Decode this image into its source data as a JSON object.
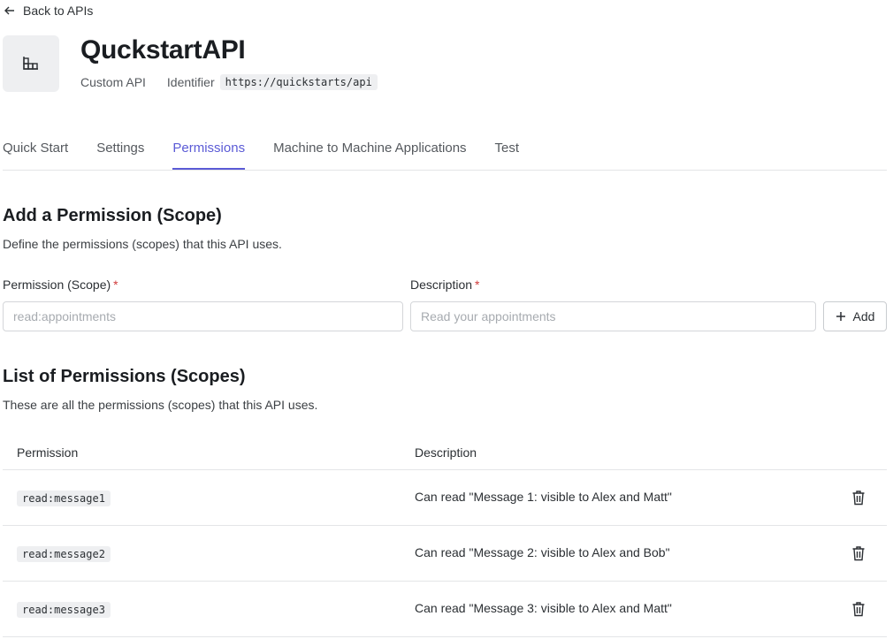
{
  "back_link": {
    "label": "Back to APIs"
  },
  "header": {
    "icon": "building-grid-icon",
    "title": "QuckstartAPI",
    "type_label": "Custom API",
    "identifier_label": "Identifier",
    "identifier_value": "https://quickstarts/api"
  },
  "tabs": [
    {
      "label": "Quick Start",
      "active": false
    },
    {
      "label": "Settings",
      "active": false
    },
    {
      "label": "Permissions",
      "active": true
    },
    {
      "label": "Machine to Machine Applications",
      "active": false
    },
    {
      "label": "Test",
      "active": false
    }
  ],
  "add_section": {
    "title": "Add a Permission (Scope)",
    "subtitle": "Define the permissions (scopes) that this API uses.",
    "permission_label": "Permission (Scope)",
    "permission_placeholder": "read:appointments",
    "description_label": "Description",
    "description_placeholder": "Read your appointments",
    "required_marker": "*",
    "add_button": "Add"
  },
  "list_section": {
    "title": "List of Permissions (Scopes)",
    "subtitle": "These are all the permissions (scopes) that this API uses.",
    "columns": {
      "permission": "Permission",
      "description": "Description"
    },
    "rows": [
      {
        "permission": "read:message1",
        "description": "Can read \"Message 1: visible to Alex and Matt\""
      },
      {
        "permission": "read:message2",
        "description": "Can read \"Message 2: visible to Alex and Bob\""
      },
      {
        "permission": "read:message3",
        "description": "Can read \"Message 3: visible to Alex and Matt\""
      }
    ]
  },
  "colors": {
    "accent": "#5b5bd6",
    "required": "#d03b3b"
  }
}
